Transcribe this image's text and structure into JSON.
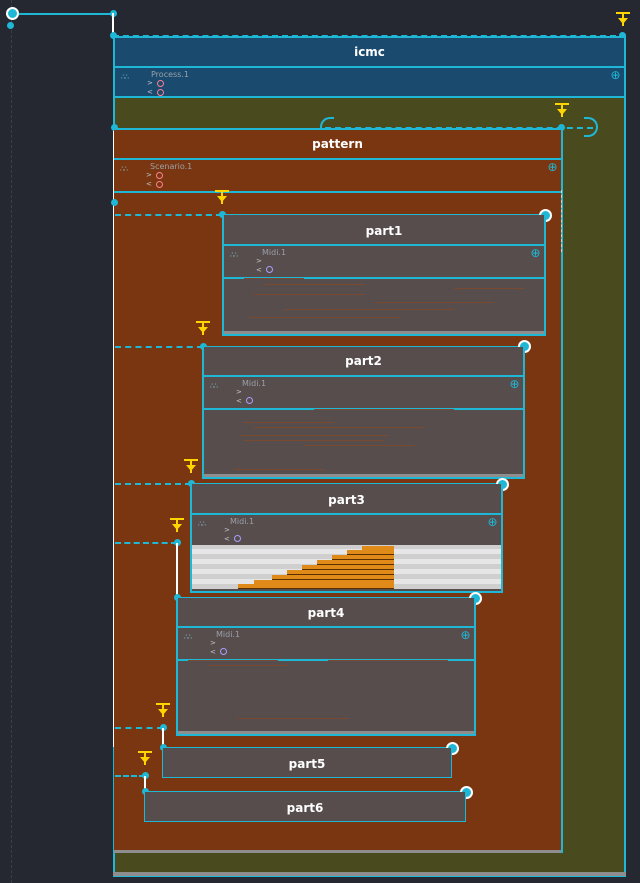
{
  "root": {
    "icmc": {
      "title": "icmc",
      "process_label": "Process.1"
    },
    "pattern": {
      "title": "pattern",
      "process_label": "Scenario.1"
    },
    "parts": [
      {
        "title": "part1",
        "process_label": "Midi.1"
      },
      {
        "title": "part2",
        "process_label": "Midi.1"
      },
      {
        "title": "part3",
        "process_label": "Midi.1"
      },
      {
        "title": "part4",
        "process_label": "Midi.1"
      },
      {
        "title": "part5"
      },
      {
        "title": "part6"
      }
    ]
  },
  "ports": {
    "out": ">",
    "in": "<"
  },
  "icons": {
    "add": "⊕",
    "grip": "∴∴"
  },
  "colors": {
    "accent": "#1eb8d6",
    "icmc_bg": "#1a4a6e",
    "pattern_bg": "#7a3611",
    "outer_bg": "#4a4a1f",
    "part_bg": "#574d4d",
    "trigger": "#ffd500"
  }
}
